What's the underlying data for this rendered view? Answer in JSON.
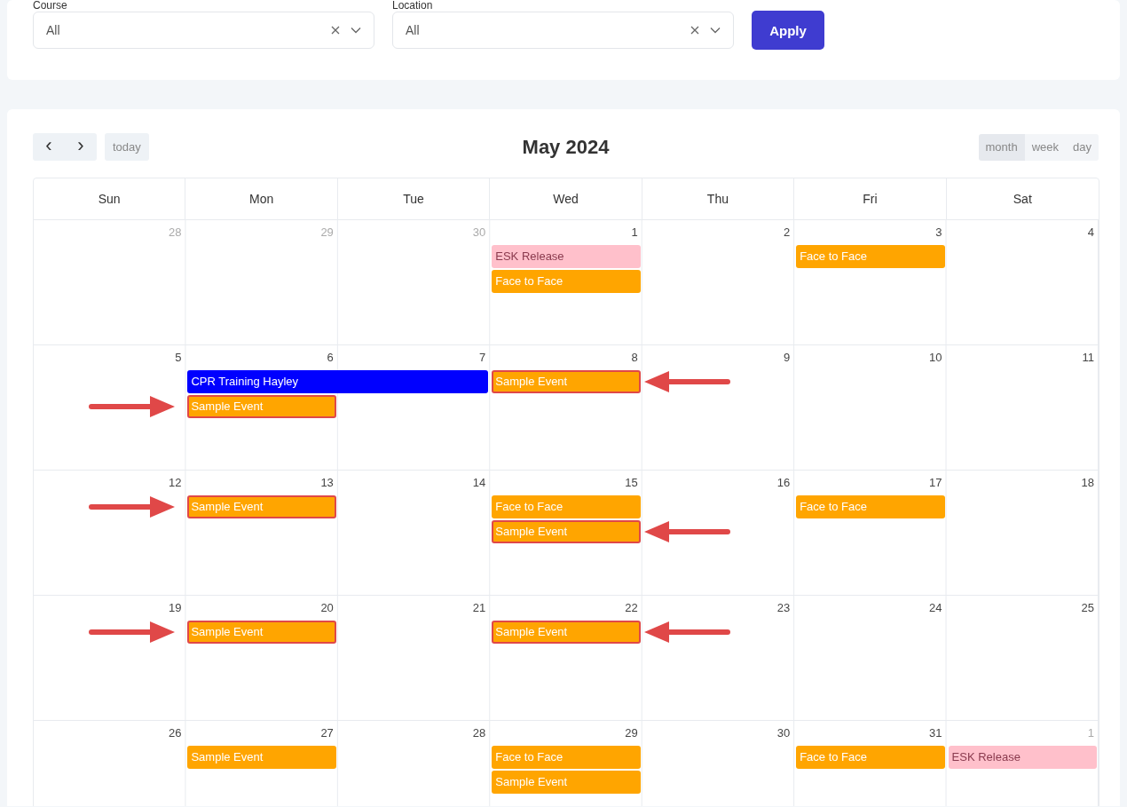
{
  "filters": [
    {
      "label": "Course",
      "value": "All"
    },
    {
      "label": "Location",
      "value": "All"
    }
  ],
  "apply_button": "Apply",
  "calendar": {
    "title": "May 2024",
    "prev": "‹",
    "next": "›",
    "today": "today",
    "views": [
      {
        "label": "month",
        "selected": true
      },
      {
        "label": "week",
        "selected": false
      },
      {
        "label": "day",
        "selected": false
      }
    ],
    "weekdays": [
      "Sun",
      "Mon",
      "Tue",
      "Wed",
      "Thu",
      "Fri",
      "Sat"
    ],
    "weeks": [
      {
        "days": [
          {
            "number": "28",
            "outside": true
          },
          {
            "number": "29",
            "outside": true
          },
          {
            "number": "30",
            "outside": true
          },
          {
            "number": "1",
            "outside": false,
            "events": [
              {
                "title": "ESK Release",
                "color": "#ffc0cb",
                "highlighted": false
              },
              {
                "title": "Face to Face",
                "color": "#ffa500",
                "highlighted": false
              }
            ]
          },
          {
            "number": "2",
            "outside": false
          },
          {
            "number": "3",
            "outside": false,
            "events": [
              {
                "title": "Face to Face",
                "color": "#ffa500",
                "highlighted": false
              }
            ]
          },
          {
            "number": "4",
            "outside": false
          }
        ]
      },
      {
        "days": [
          {
            "number": "5",
            "outside": false
          },
          {
            "number": "6",
            "outside": false,
            "events": [
              {
                "title": "CPR Training Hayley",
                "color": "#0000ff",
                "spans_next_day": true,
                "highlighted": false
              },
              {
                "title": "Sample Event",
                "color": "#ffa500",
                "highlighted": true,
                "arrow_from_left": true
              }
            ]
          },
          {
            "number": "7",
            "outside": false
          },
          {
            "number": "8",
            "outside": false,
            "events": [
              {
                "title": "Sample Event",
                "color": "#ffa500",
                "highlighted": true,
                "arrow_from_right": true
              }
            ]
          },
          {
            "number": "9",
            "outside": false
          },
          {
            "number": "10",
            "outside": false
          },
          {
            "number": "11",
            "outside": false
          }
        ]
      },
      {
        "days": [
          {
            "number": "12",
            "outside": false
          },
          {
            "number": "13",
            "outside": false,
            "events": [
              {
                "title": "Sample Event",
                "color": "#ffa500",
                "highlighted": true,
                "arrow_from_left": true
              }
            ]
          },
          {
            "number": "14",
            "outside": false
          },
          {
            "number": "15",
            "outside": false,
            "events": [
              {
                "title": "Face to Face",
                "color": "#ffa500",
                "highlighted": false
              },
              {
                "title": "Sample Event",
                "color": "#ffa500",
                "highlighted": true,
                "arrow_from_right": true
              }
            ]
          },
          {
            "number": "16",
            "outside": false
          },
          {
            "number": "17",
            "outside": false,
            "events": [
              {
                "title": "Face to Face",
                "color": "#ffa500",
                "highlighted": false
              }
            ]
          },
          {
            "number": "18",
            "outside": false
          }
        ]
      },
      {
        "days": [
          {
            "number": "19",
            "outside": false
          },
          {
            "number": "20",
            "outside": false,
            "events": [
              {
                "title": "Sample Event",
                "color": "#ffa500",
                "highlighted": true,
                "arrow_from_left": true
              }
            ]
          },
          {
            "number": "21",
            "outside": false
          },
          {
            "number": "22",
            "outside": false,
            "events": [
              {
                "title": "Sample Event",
                "color": "#ffa500",
                "highlighted": true,
                "arrow_from_right": true
              }
            ]
          },
          {
            "number": "23",
            "outside": false
          },
          {
            "number": "24",
            "outside": false
          },
          {
            "number": "25",
            "outside": false
          }
        ]
      },
      {
        "days": [
          {
            "number": "26",
            "outside": false
          },
          {
            "number": "27",
            "outside": false,
            "events": [
              {
                "title": "Sample Event",
                "color": "#ffa500",
                "highlighted": false
              }
            ]
          },
          {
            "number": "28",
            "outside": false
          },
          {
            "number": "29",
            "outside": false,
            "events": [
              {
                "title": "Face to Face",
                "color": "#ffa500",
                "highlighted": false
              },
              {
                "title": "Sample Event",
                "color": "#ffa500",
                "highlighted": false
              }
            ]
          },
          {
            "number": "30",
            "outside": false
          },
          {
            "number": "31",
            "outside": false,
            "events": [
              {
                "title": "Face to Face",
                "color": "#ffa500",
                "highlighted": false
              }
            ]
          },
          {
            "number": "1",
            "outside": true,
            "events": [
              {
                "title": "ESK Release",
                "color": "#ffc0cb",
                "highlighted": false
              }
            ]
          }
        ]
      }
    ]
  }
}
